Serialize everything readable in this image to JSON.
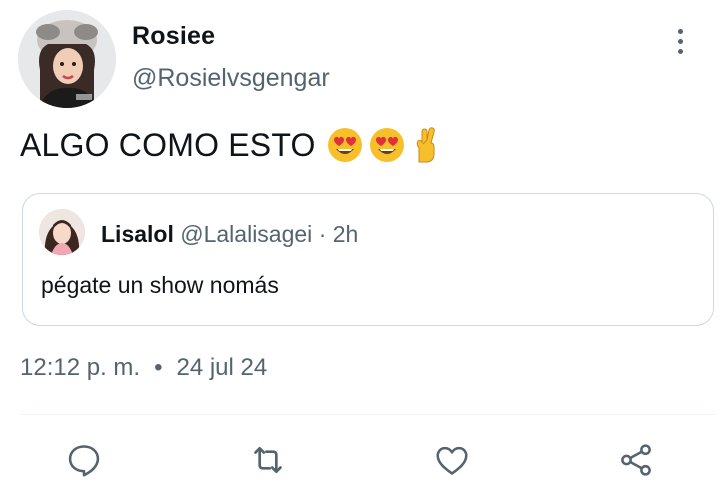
{
  "tweet": {
    "author_name": "Rosiee",
    "author_handle": "@Rosielvsgengar",
    "text": "ALGO COMO ESTO",
    "emojis": [
      "heart-eyes-emoji",
      "heart-eyes-emoji",
      "crossed-fingers-emoji"
    ],
    "time": "12:12 p. m.",
    "separator": "•",
    "date": "24 jul 24"
  },
  "quote": {
    "author_name": "Lisalol",
    "author_handle": "@Lalalisagei",
    "dot": "·",
    "age": "2h",
    "text": "pégate un show nomás"
  },
  "actions": [
    "reply-icon",
    "retweet-icon",
    "like-icon",
    "share-icon"
  ],
  "colors": {
    "text": "#0f1419",
    "secondary": "#536471",
    "border": "#cfd9de",
    "icon": "#536471"
  }
}
